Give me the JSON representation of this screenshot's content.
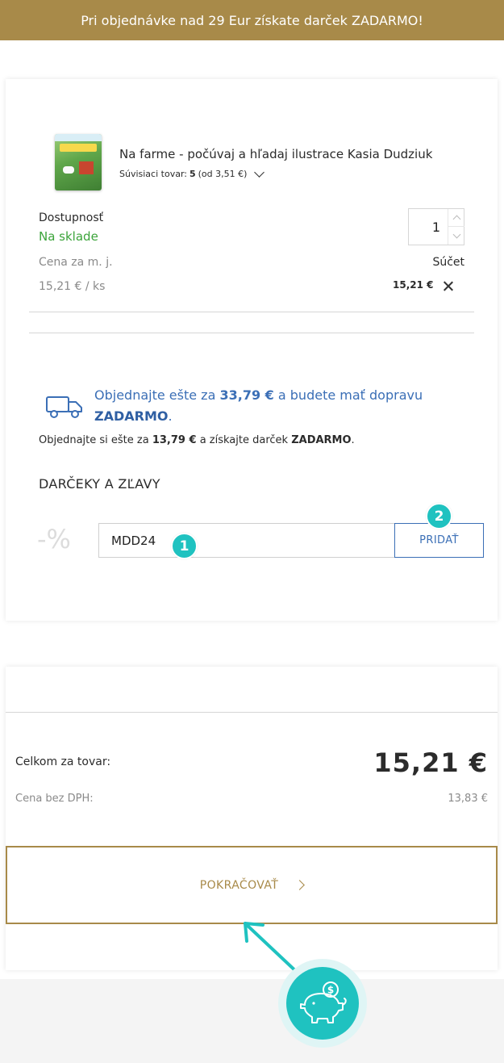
{
  "colors": {
    "brand_gold": "#a88a49",
    "link_blue": "#3b6fb6",
    "in_stock_green": "#3ca43b",
    "marker_teal": "#1fc2c0"
  },
  "banner": {
    "text": "Pri objednávke nad 29 Eur získate darček ZADARMO!"
  },
  "cart_item": {
    "name": "Na farme - počúvaj a hľadaj ilustrace Kasia Dudziuk",
    "related_label": "Súvisiaci tovar:",
    "related_count": "5",
    "related_from": "(od 3,51 €)",
    "availability_label": "Dostupnosť",
    "availability_value": "Na sklade",
    "quantity": "1",
    "unit_price_label": "Cena za m. j.",
    "unit_price": "15,21 € / ks",
    "sum_label": "Súčet",
    "sum": "15,21 €"
  },
  "shipping": {
    "free_shipping_pre": "Objednajte ešte za",
    "free_shipping_amount": "33,79 €",
    "free_shipping_post": "a budete mať dopravu",
    "free_shipping_word": "ZADARMO",
    "gift_pre": "Objednajte si ešte za",
    "gift_amount": "13,79 €",
    "gift_post": "a získajte darček",
    "gift_word": "ZADARMO"
  },
  "discounts": {
    "heading": "DARČEKY A ZĽAVY",
    "percent_glyph": "-%",
    "coupon_value": "MDD24",
    "add_label": "PRIDAŤ"
  },
  "markers": {
    "m1": "1",
    "m2": "2"
  },
  "summary": {
    "total_label": "Celkom za tovar:",
    "total_value": "15,21 €",
    "net_label": "Cena bez DPH:",
    "net_value": "13,83 €",
    "continue_label": "POKRAČOVAŤ"
  },
  "icons": [
    "chevron-down-icon",
    "close-icon",
    "truck-icon",
    "chevron-right-icon",
    "pointer-arrow-icon",
    "piggy-bank-icon"
  ]
}
